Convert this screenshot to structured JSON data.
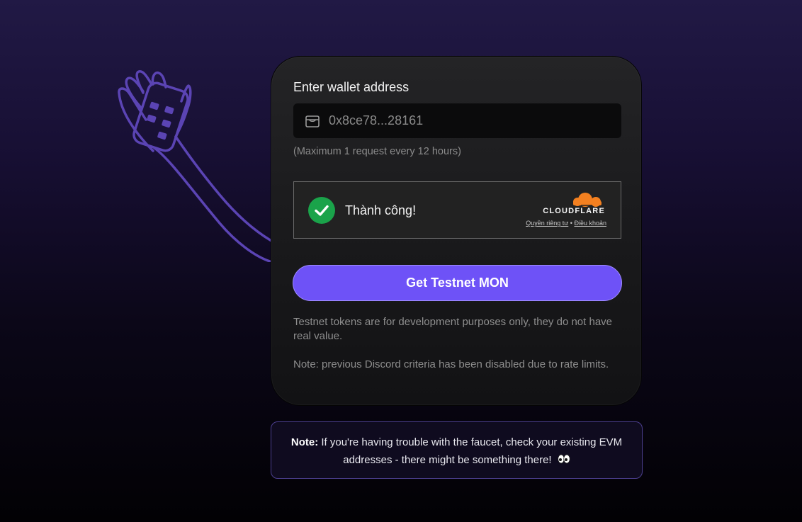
{
  "wallet": {
    "label": "Enter wallet address",
    "value": "0x8ce78...28161",
    "helper": "(Maximum 1 request every 12 hours)"
  },
  "captcha": {
    "status": "Thành công!",
    "provider": "CLOUDFLARE",
    "privacy_link": "Quyền riêng tư",
    "separator": "•",
    "terms_link": "Điều khoản"
  },
  "cta": {
    "label": "Get Testnet MON"
  },
  "info": {
    "disclaimer": "Testnet tokens are for development purposes only, they do not have real value.",
    "discord_note": "Note: previous Discord criteria has been disabled due to rate limits."
  },
  "note_box": {
    "label": "Note:",
    "text": "If you're having trouble with the faucet, check your existing EVM addresses - there might be something there!"
  },
  "colors": {
    "accent": "#6e52f7",
    "success": "#1aa34a",
    "cloudflare_orange": "#f38020",
    "illustration_stroke": "#5b44b4"
  },
  "icons": {
    "wallet": "wallet-icon",
    "success": "checkmark-icon",
    "eyes": "eyes-emoji-icon",
    "illustration": "hand-holding-phone-illustration"
  }
}
